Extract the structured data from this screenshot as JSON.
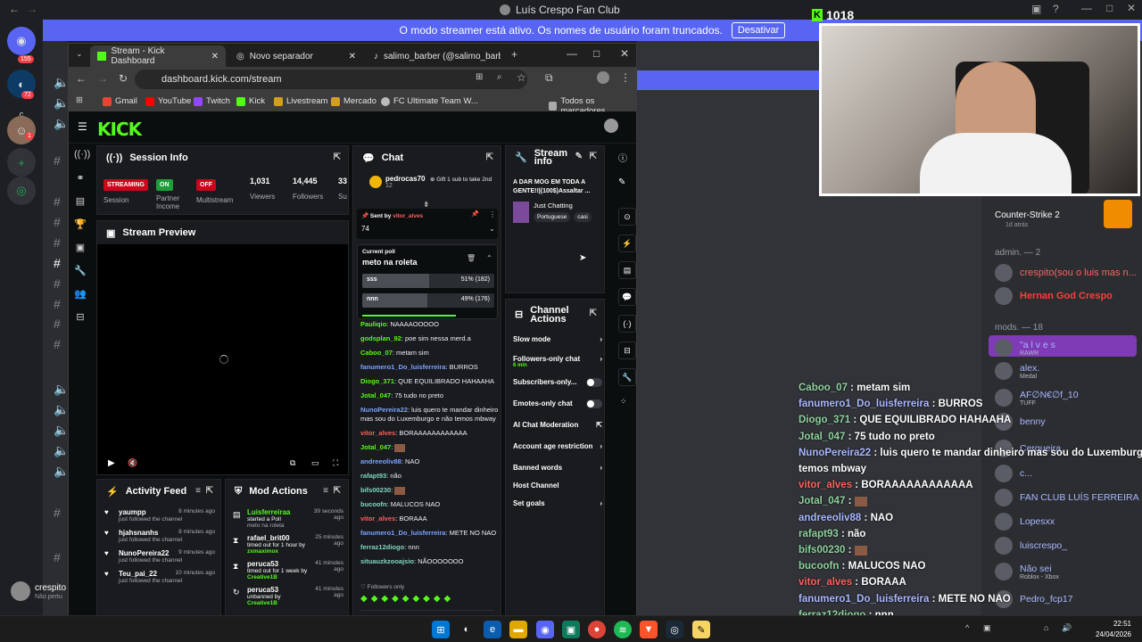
{
  "window_title": "Luís Crespo Fan Club",
  "banner": {
    "text": "O modo streamer está ativo. Os nomes de usuário foram truncados.",
    "button": "Desativar"
  },
  "server_badges": [
    "155",
    "72",
    "1"
  ],
  "kick_overlay_count": "1018",
  "browser": {
    "tabs": [
      "Stream - Kick Dashboard",
      "Novo separador",
      "salimo_barber (@salimo_barbe"
    ],
    "url": "dashboard.kick.com/stream",
    "bookmarks": [
      "Gmail",
      "YouTube",
      "Twitch",
      "Kick",
      "Livestream",
      "Mercado",
      "FC Ultimate Team W...",
      "Todos os marcadores"
    ]
  },
  "kick": {
    "session_info": {
      "title": "Session Info",
      "stats": [
        {
          "value": "STREAMING",
          "label": "Session"
        },
        {
          "value": "ON",
          "label": "Partner Income"
        },
        {
          "value": "OFF",
          "label": "Multistream"
        },
        {
          "value": "1,031",
          "label": "Viewers"
        },
        {
          "value": "14,445",
          "label": "Followers"
        },
        {
          "value": "33",
          "label": "Su"
        }
      ]
    },
    "stream_preview": {
      "title": "Stream Preview"
    },
    "chat": {
      "title": "Chat",
      "top_user": "pedrocas70",
      "top_count": "12",
      "gift_text": "Gift 1 sub to take 2nd",
      "pinned_by_label": "Sent by",
      "pinned_by": "vitor_alves",
      "pinned_msg": "74",
      "poll_label": "Current poll",
      "poll_question": "meto na roleta",
      "poll_options": [
        {
          "label": "sss",
          "pct": "51%",
          "count": "(182)",
          "share": 0.51
        },
        {
          "label": "nnn",
          "pct": "49%",
          "count": "(176)",
          "share": 0.49
        }
      ],
      "messages": [
        {
          "user": "Pauliqio",
          "text": "NAAAAOOOOO",
          "color": "g"
        },
        {
          "user": "godsplan_92",
          "text": "poe sim nessa merd.a",
          "color": "g"
        },
        {
          "user": "Caboo_07",
          "text": "metam sim",
          "color": "g"
        },
        {
          "user": "fanumero1_Do_luisferreira",
          "text": "BURROS",
          "color": "b"
        },
        {
          "user": "Diogo_371",
          "text": "QUE EQUILIBRADO HAHAAHA",
          "color": "g"
        },
        {
          "user": "Jotal_047",
          "text": "75 tudo no preto",
          "color": "g"
        },
        {
          "user": "NunoPereira22",
          "text": "luis quero te mandar dinheiro mas sou do Luxemburgo e não temos mbway",
          "color": "b"
        },
        {
          "user": "vitor_alves",
          "text": "BORAAAAAAAAAAAA",
          "color": "r"
        },
        {
          "user": "Jotal_047",
          "text": "",
          "color": "g"
        },
        {
          "user": "andreeoliv88",
          "text": "NAO",
          "color": "b"
        },
        {
          "user": "rafapt93",
          "text": "não",
          "color": "c"
        },
        {
          "user": "bifs00230",
          "text": "",
          "color": "c"
        },
        {
          "user": "bucoofn",
          "text": "MALUCOS NAO",
          "color": "c"
        },
        {
          "user": "vitor_alves",
          "text": "BORAAA",
          "color": "r"
        },
        {
          "user": "fanumero1_Do_luisferreira",
          "text": "METE NO NAO",
          "color": "b"
        },
        {
          "user": "ferraz12diogo",
          "text": "nnn",
          "color": "c"
        },
        {
          "user": "situauzkzooajsio",
          "text": "NÃOOOOOOO",
          "color": "c"
        }
      ],
      "followers_only": "Followers only"
    },
    "stream_info": {
      "title": "Stream info",
      "stream_title": "A DAR MOG EM TODA A GENTE!!|(100$)Assaltar ...",
      "category": "Just Chatting",
      "tags": [
        "Portuguese",
        "casi"
      ]
    },
    "channel_actions": {
      "title": "Channel Actions",
      "items": [
        {
          "label": "Slow mode",
          "kind": "arrow",
          "sub": ""
        },
        {
          "label": "Followers-only chat",
          "kind": "arrow",
          "sub": "6 min"
        },
        {
          "label": "Subscribers-only...",
          "kind": "toggle",
          "sub": ""
        },
        {
          "label": "Emotes-only chat",
          "kind": "toggle",
          "sub": ""
        },
        {
          "label": "AI Chat Moderation",
          "kind": "ext",
          "sub": ""
        },
        {
          "label": "Account age restriction",
          "kind": "arrow",
          "sub": ""
        },
        {
          "label": "Banned words",
          "kind": "arrow",
          "sub": ""
        },
        {
          "label": "Host Channel",
          "kind": "none",
          "sub": ""
        },
        {
          "label": "Set goals",
          "kind": "arrow",
          "sub": ""
        }
      ]
    },
    "activity_feed": {
      "title": "Activity Feed",
      "items": [
        {
          "name": "yaumpp",
          "sub": "just followed the channel",
          "time": "8 minutes ago"
        },
        {
          "name": "hjahsnanhs",
          "sub": "just followed the channel",
          "time": "8 minutes ago"
        },
        {
          "name": "NunoPereira22",
          "sub": "just followed the channel",
          "time": "9 minutes ago"
        },
        {
          "name": "Teu_pai_22",
          "sub": "just followed the channel",
          "time": "10 minutes ago"
        }
      ]
    },
    "mod_actions": {
      "title": "Mod Actions",
      "items": [
        {
          "name": "Luisferreiraa",
          "action": "started a Poll",
          "detail": "meto na roleta",
          "time": "39 seconds ago"
        },
        {
          "name": "rafael_brit00",
          "action": "timed out for 1 hour by",
          "detail": "zxmaximox",
          "time": "25 minutes ago"
        },
        {
          "name": "peruca53",
          "action": "timed out for 1 week by",
          "detail": "Creative1B",
          "time": "41 minutes ago"
        },
        {
          "name": "peruca53",
          "action": "unbanned by",
          "detail": "Creative1B",
          "time": "41 minutes ago"
        }
      ]
    }
  },
  "discord": {
    "recent_game": "Counter-Strike 2",
    "recent_time": "1d atrás",
    "admin_header": "admin. — 2",
    "admins": [
      {
        "name": "crespito(sou o luis mas n...",
        "color": "#ff6161"
      },
      {
        "name": "Hernan God Crespo",
        "color": "#ff3b3b"
      }
    ],
    "mods_header": "mods. — 18",
    "mods": [
      {
        "name": "\"a l v e s",
        "sub": "RAWR"
      },
      {
        "name": "alex.",
        "sub": "Medal"
      },
      {
        "name": "AF∅N€∅f_10",
        "sub": "TUFF"
      },
      {
        "name": "benny",
        "sub": ""
      },
      {
        "name": "Cerqueira",
        "sub": ""
      },
      {
        "name": "c...",
        "sub": ""
      },
      {
        "name": "FAN CLUB LUÍS FERREIRA",
        "sub": ""
      },
      {
        "name": "Lopesxx",
        "sub": ""
      },
      {
        "name": "luiscrespo_",
        "sub": ""
      },
      {
        "name": "Não sei",
        "sub": "Roblox - Xbox"
      },
      {
        "name": "Pedro_fcp17",
        "sub": ""
      }
    ],
    "self_user": "crespito",
    "self_status": "Não pertu",
    "overlay_chat": [
      {
        "user": "Caboo_07",
        "text": "metam sim",
        "c": "n"
      },
      {
        "user": "fanumero1_Do_luisferreira",
        "text": "BURROS",
        "c": "nb"
      },
      {
        "user": "Diogo_371",
        "text": "QUE EQUILIBRADO HAHAAHA",
        "c": "n"
      },
      {
        "user": "Jotal_047",
        "text": "75 tudo no preto",
        "c": "n"
      },
      {
        "user": "NunoPereira22",
        "text": "luis quero te mandar dinheiro mas sou do Luxemburgo e não",
        "c": "nb"
      },
      {
        "user": "",
        "text": "temos mbway",
        "c": "n"
      },
      {
        "user": "vitor_alves",
        "text": "BORAAAAAAAAAAAA",
        "c": "nr"
      },
      {
        "user": "Jotal_047",
        "text": "",
        "c": "n"
      },
      {
        "user": "andreeoliv88",
        "text": "NAO",
        "c": "nb"
      },
      {
        "user": "rafapt93",
        "text": "não",
        "c": "n"
      },
      {
        "user": "bifs00230",
        "text": "",
        "c": "n"
      },
      {
        "user": "bucoofn",
        "text": "MALUCOS NAO",
        "c": "n"
      },
      {
        "user": "vitor_alves",
        "text": "BORAAA",
        "c": "nr"
      },
      {
        "user": "fanumero1_Do_luisferreira",
        "text": "METE NO NAO",
        "c": "nb"
      },
      {
        "user": "ferraz12diogo",
        "text": "nnn",
        "c": "n"
      },
      {
        "user": "situauzkzooajsio",
        "text": "NÃOOOOOOO",
        "c": "n"
      }
    ]
  },
  "taskbar": {
    "time": "22:51",
    "date": "24/04/2026"
  }
}
